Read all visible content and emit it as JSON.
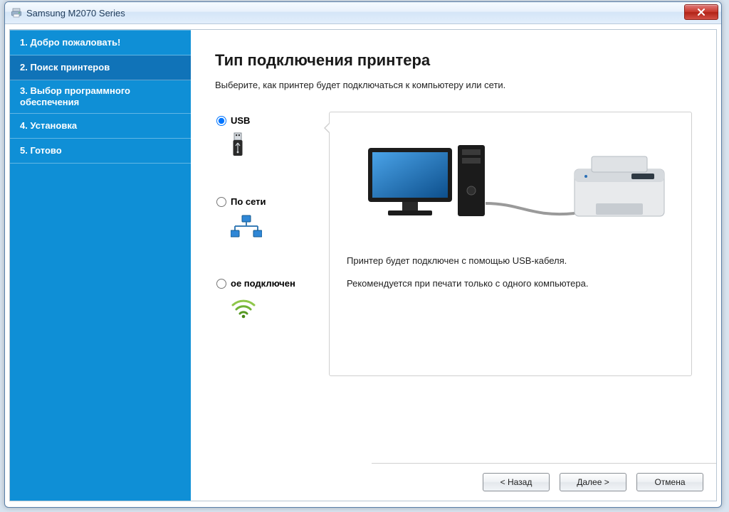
{
  "window": {
    "title": "Samsung M2070 Series"
  },
  "sidebar": {
    "steps": [
      "1. Добро пожаловать!",
      "2. Поиск принтеров",
      "3. Выбор программного обеспечения",
      "4. Установка",
      "5. Готово"
    ],
    "active_index": 1
  },
  "main": {
    "heading": "Тип подключения принтера",
    "subtitle": "Выберите, как принтер будет подключаться к компьютеру или сети."
  },
  "options": {
    "usb": {
      "label": "USB",
      "selected": true
    },
    "network": {
      "label": "По сети",
      "selected": false
    },
    "wireless": {
      "label": "ое подключен",
      "selected": false
    }
  },
  "preview": {
    "line1": "Принтер будет подключен с помощью USB-кабеля.",
    "line2": "Рекомендуется при печати только с одного компьютера."
  },
  "buttons": {
    "back": "< Назад",
    "next": "Далее >",
    "cancel": "Отмена"
  }
}
